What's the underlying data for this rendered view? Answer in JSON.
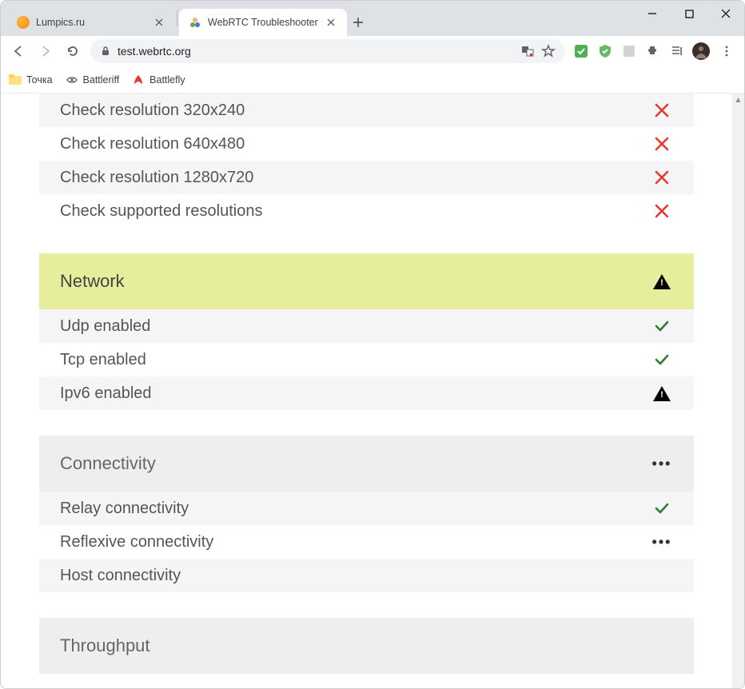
{
  "window": {
    "tabs": [
      {
        "title": "Lumpics.ru",
        "favicon": "orange-circle",
        "active": false
      },
      {
        "title": "WebRTC Troubleshooter",
        "favicon": "webrtc",
        "active": true
      }
    ],
    "url": "test.webrtc.org"
  },
  "bookmarks": [
    {
      "label": "Точка",
      "icon": "yellow-folder"
    },
    {
      "label": "Battleriff",
      "icon": "battleriff"
    },
    {
      "label": "Battlefly",
      "icon": "battlefly"
    }
  ],
  "sections": [
    {
      "header": null,
      "header_style": null,
      "header_status": null,
      "rows": [
        {
          "label": "Check resolution 320x240",
          "status": "fail"
        },
        {
          "label": "Check resolution 640x480",
          "status": "fail"
        },
        {
          "label": "Check resolution 1280x720",
          "status": "fail"
        },
        {
          "label": "Check supported resolutions",
          "status": "fail"
        }
      ]
    },
    {
      "header": "Network",
      "header_style": "yellow",
      "header_status": "warn",
      "rows": [
        {
          "label": "Udp enabled",
          "status": "pass"
        },
        {
          "label": "Tcp enabled",
          "status": "pass"
        },
        {
          "label": "Ipv6 enabled",
          "status": "warn"
        }
      ]
    },
    {
      "header": "Connectivity",
      "header_style": "gray",
      "header_status": "running",
      "rows": [
        {
          "label": "Relay connectivity",
          "status": "pass"
        },
        {
          "label": "Reflexive connectivity",
          "status": "running"
        },
        {
          "label": "Host connectivity",
          "status": "none"
        }
      ]
    },
    {
      "header": "Throughput",
      "header_style": "gray",
      "header_status": "none",
      "rows": []
    }
  ]
}
